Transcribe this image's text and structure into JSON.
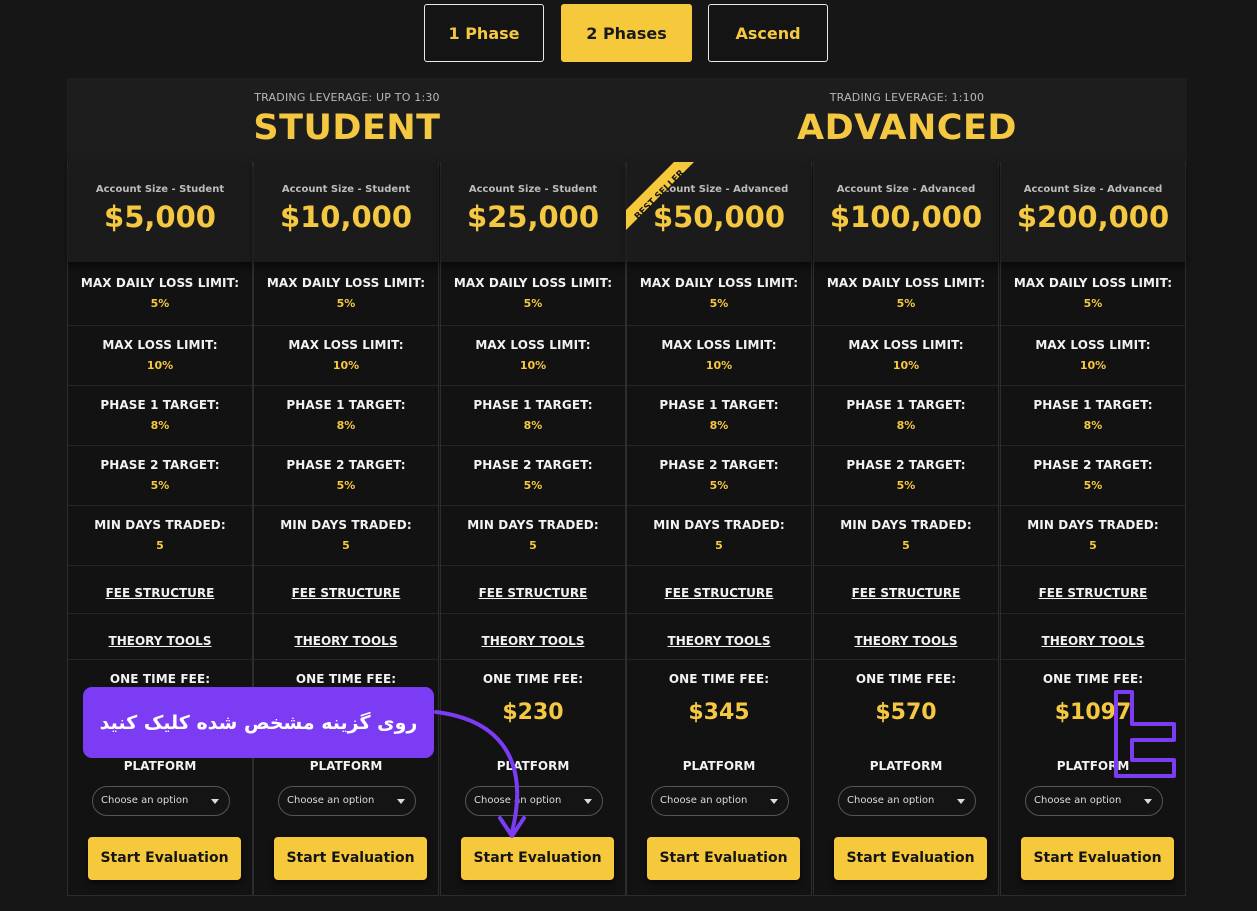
{
  "tabs": [
    {
      "label": "1 Phase",
      "active": false
    },
    {
      "label": "2 Phases",
      "active": true
    },
    {
      "label": "Ascend",
      "active": false
    }
  ],
  "groups": [
    {
      "leverage": "TRADING LEVERAGE: UP TO 1:30",
      "title": "STUDENT"
    },
    {
      "leverage": "TRADING LEVERAGE: 1:100",
      "title": "ADVANCED"
    }
  ],
  "ribbon": "BEST SELLER",
  "row_labels": {
    "max_daily_loss": "MAX DAILY LOSS LIMIT:",
    "max_loss": "MAX LOSS LIMIT:",
    "phase1": "PHASE 1 TARGET:",
    "phase2": "PHASE 2 TARGET:",
    "min_days": "MIN DAYS TRADED:",
    "fee_structure": "FEE STRUCTURE",
    "theory_tools": "THEORY TOOLS",
    "one_time_fee": "ONE TIME FEE:",
    "platform": "PLATFORM",
    "select_placeholder": "Choose an option",
    "start": "Start Evaluation"
  },
  "plans": [
    {
      "size_label": "Account Size - Student",
      "size": "$5,000",
      "max_daily_loss": "5%",
      "max_loss": "10%",
      "phase1": "8%",
      "phase2": "5%",
      "min_days": "5",
      "fee": ""
    },
    {
      "size_label": "Account Size - Student",
      "size": "$10,000",
      "max_daily_loss": "5%",
      "max_loss": "10%",
      "phase1": "8%",
      "phase2": "5%",
      "min_days": "5",
      "fee": ""
    },
    {
      "size_label": "Account Size - Student",
      "size": "$25,000",
      "max_daily_loss": "5%",
      "max_loss": "10%",
      "phase1": "8%",
      "phase2": "5%",
      "min_days": "5",
      "fee": "$230"
    },
    {
      "size_label": "Account Size - Advanced",
      "size": "$50,000",
      "max_daily_loss": "5%",
      "max_loss": "10%",
      "phase1": "8%",
      "phase2": "5%",
      "min_days": "5",
      "fee": "$345"
    },
    {
      "size_label": "Account Size - Advanced",
      "size": "$100,000",
      "max_daily_loss": "5%",
      "max_loss": "10%",
      "phase1": "8%",
      "phase2": "5%",
      "min_days": "5",
      "fee": "$570"
    },
    {
      "size_label": "Account Size - Advanced",
      "size": "$200,000",
      "max_daily_loss": "5%",
      "max_loss": "10%",
      "phase1": "8%",
      "phase2": "5%",
      "min_days": "5",
      "fee": "$1097"
    }
  ],
  "callout": {
    "text": "روی گزینه مشخص شده کلیک کنید"
  },
  "colors": {
    "accent": "#f6c93c",
    "callout": "#7b3cf3",
    "background": "#161616"
  }
}
